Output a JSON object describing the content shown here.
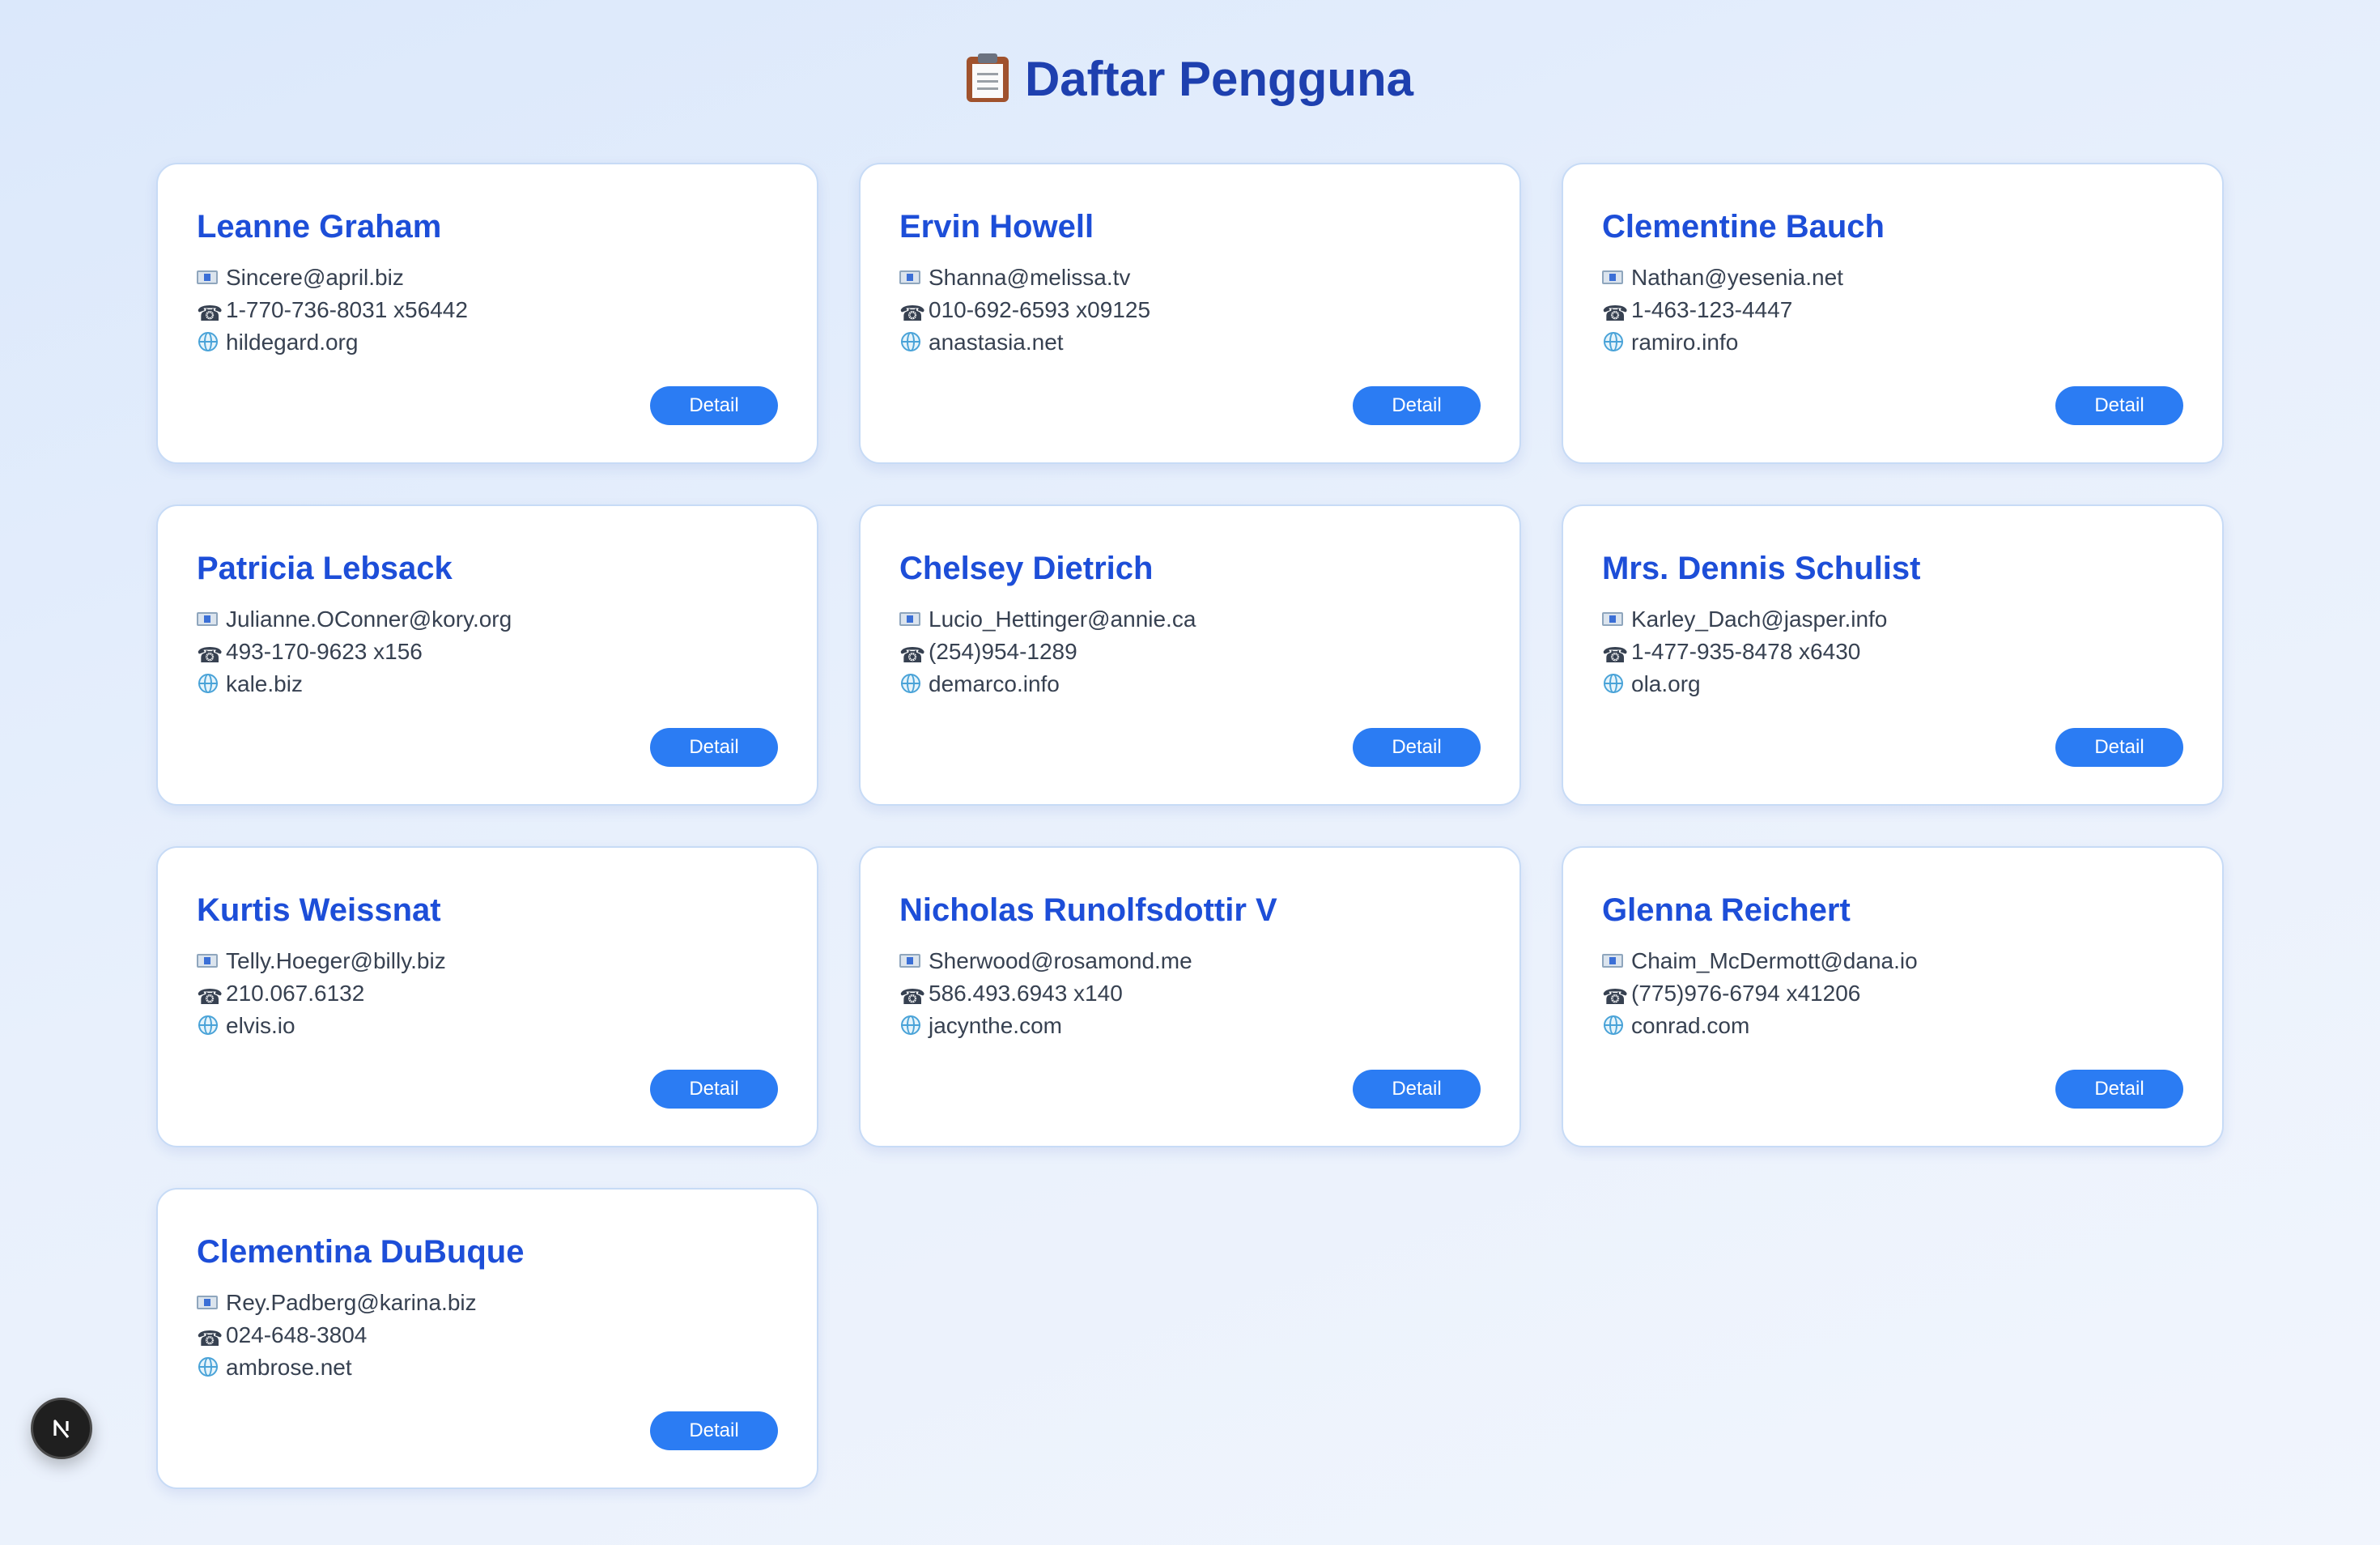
{
  "page": {
    "title": "Daftar Pengguna",
    "title_icon": "clipboard-icon"
  },
  "users": [
    {
      "name": "Leanne Graham",
      "email": "Sincere@april.biz",
      "phone": "1-770-736-8031 x56442",
      "website": "hildegard.org",
      "button": "Detail"
    },
    {
      "name": "Ervin Howell",
      "email": "Shanna@melissa.tv",
      "phone": "010-692-6593 x09125",
      "website": "anastasia.net",
      "button": "Detail"
    },
    {
      "name": "Clementine Bauch",
      "email": "Nathan@yesenia.net",
      "phone": "1-463-123-4447",
      "website": "ramiro.info",
      "button": "Detail"
    },
    {
      "name": "Patricia Lebsack",
      "email": "Julianne.OConner@kory.org",
      "phone": "493-170-9623 x156",
      "website": "kale.biz",
      "button": "Detail"
    },
    {
      "name": "Chelsey Dietrich",
      "email": "Lucio_Hettinger@annie.ca",
      "phone": "(254)954-1289",
      "website": "demarco.info",
      "button": "Detail"
    },
    {
      "name": "Mrs. Dennis Schulist",
      "email": "Karley_Dach@jasper.info",
      "phone": "1-477-935-8478 x6430",
      "website": "ola.org",
      "button": "Detail"
    },
    {
      "name": "Kurtis Weissnat",
      "email": "Telly.Hoeger@billy.biz",
      "phone": "210.067.6132",
      "website": "elvis.io",
      "button": "Detail"
    },
    {
      "name": "Nicholas Runolfsdottir V",
      "email": "Sherwood@rosamond.me",
      "phone": "586.493.6943 x140",
      "website": "jacynthe.com",
      "button": "Detail"
    },
    {
      "name": "Glenna Reichert",
      "email": "Chaim_McDermott@dana.io",
      "phone": "(775)976-6794 x41206",
      "website": "conrad.com",
      "button": "Detail"
    },
    {
      "name": "Clementina DuBuque",
      "email": "Rey.Padberg@karina.biz",
      "phone": "024-648-3804",
      "website": "ambrose.net",
      "button": "Detail"
    }
  ],
  "icons": {
    "email": "envelope-icon",
    "phone": "telephone-icon",
    "website": "globe-icon",
    "floating": "nextjs-logo-icon"
  },
  "colors": {
    "title": "#1e40af",
    "name": "#1d4ed8",
    "button": "#2b7cf3",
    "card_border": "#c7dbf6"
  }
}
